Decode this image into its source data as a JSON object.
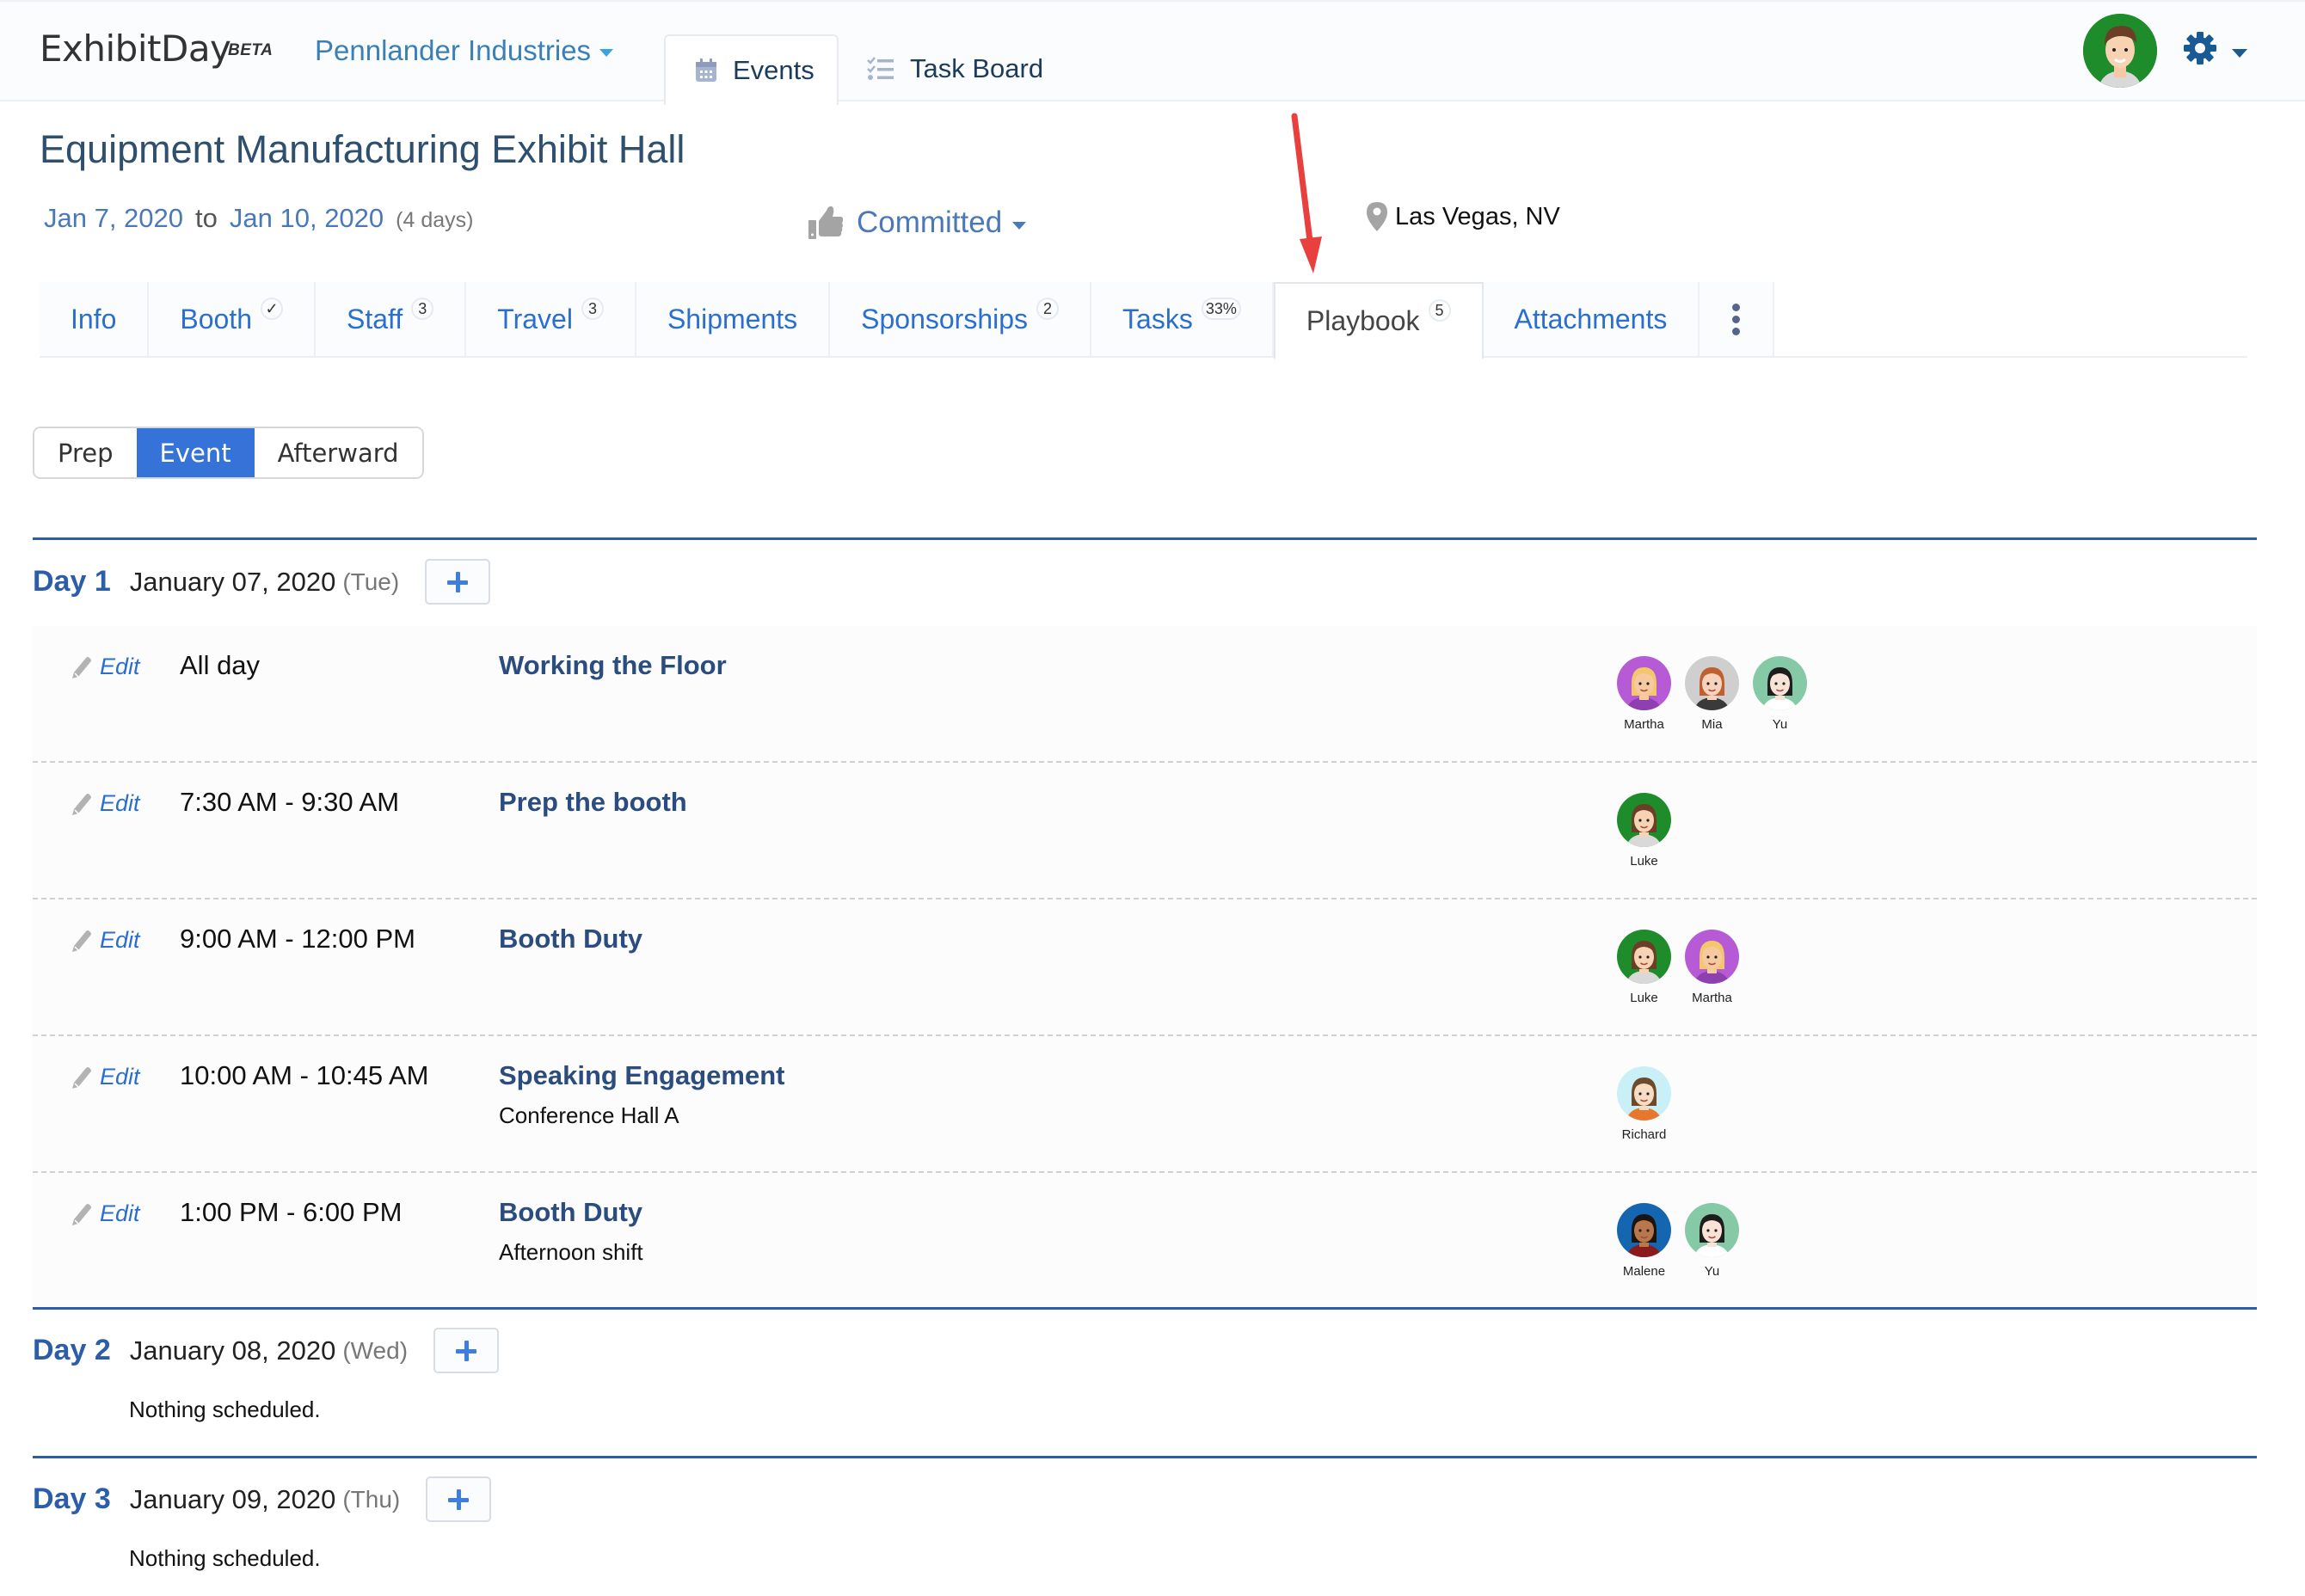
{
  "header": {
    "logo": "ExhibitDay",
    "logo_badge": "BETA",
    "organization": "Pennlander Industries",
    "nav_tabs": [
      {
        "label": "Events",
        "icon": "calendar-icon",
        "active": true
      },
      {
        "label": "Task Board",
        "icon": "checklist-icon",
        "active": false
      }
    ],
    "user_avatar": "user-avatar",
    "settings_icon": "gear-icon"
  },
  "event": {
    "title": "Equipment Manufacturing Exhibit Hall",
    "start_date": "Jan 7, 2020",
    "to_label": "to",
    "end_date": "Jan 10, 2020",
    "duration": "(4 days)",
    "status": "Committed",
    "location": "Las Vegas, NV"
  },
  "subtabs": [
    {
      "label": "Info",
      "badge": null
    },
    {
      "label": "Booth",
      "badge": "✓"
    },
    {
      "label": "Staff",
      "badge": "3"
    },
    {
      "label": "Travel",
      "badge": "3"
    },
    {
      "label": "Shipments",
      "badge": null
    },
    {
      "label": "Sponsorships",
      "badge": "2"
    },
    {
      "label": "Tasks",
      "badge": "33%"
    },
    {
      "label": "Playbook",
      "badge": "5",
      "active": true
    },
    {
      "label": "Attachments",
      "badge": null
    }
  ],
  "phase_toggle": {
    "options": [
      "Prep",
      "Event",
      "Afterward"
    ],
    "selected": "Event"
  },
  "colors": {
    "accent": "#2c5da8",
    "active_toggle": "#3573d9",
    "link": "#2a6fcf",
    "annotation_arrow": "#e8403f"
  },
  "days": [
    {
      "label": "Day 1",
      "date": "January 07, 2020",
      "weekday": "(Tue)",
      "items": [
        {
          "edit": "Edit",
          "time": "All day",
          "name": "Working the Floor",
          "sub": "",
          "people": [
            "Martha",
            "Mia",
            "Yu"
          ]
        },
        {
          "edit": "Edit",
          "time": "7:30 AM - 9:30 AM",
          "name": "Prep the booth",
          "sub": "",
          "people": [
            "Luke"
          ]
        },
        {
          "edit": "Edit",
          "time": "9:00 AM - 12:00 PM",
          "name": "Booth Duty",
          "sub": "",
          "people": [
            "Luke",
            "Martha"
          ]
        },
        {
          "edit": "Edit",
          "time": "10:00 AM - 10:45 AM",
          "name": "Speaking Engagement",
          "sub": "Conference Hall A",
          "people": [
            "Richard"
          ]
        },
        {
          "edit": "Edit",
          "time": "1:00 PM - 6:00 PM",
          "name": "Booth Duty",
          "sub": "Afternoon shift",
          "people": [
            "Malene",
            "Yu"
          ]
        }
      ]
    },
    {
      "label": "Day 2",
      "date": "January 08, 2020",
      "weekday": "(Wed)",
      "empty_text": "Nothing scheduled."
    },
    {
      "label": "Day 3",
      "date": "January 09, 2020",
      "weekday": "(Thu)",
      "empty_text": "Nothing scheduled."
    }
  ]
}
